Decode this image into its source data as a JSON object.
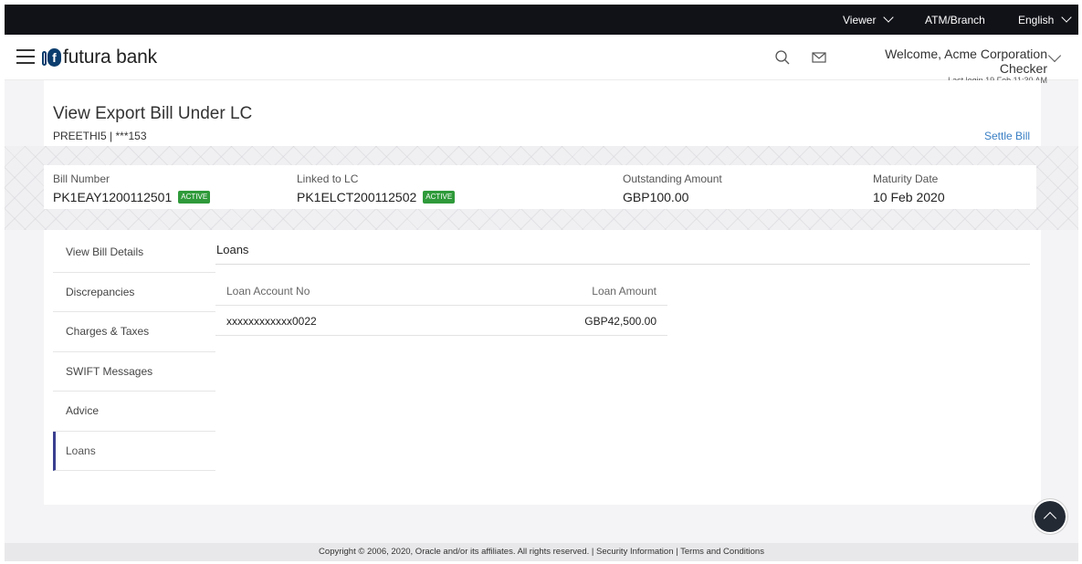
{
  "topbar": {
    "viewer_label": "Viewer",
    "atm_branch_label": "ATM/Branch",
    "language_label": "English"
  },
  "header": {
    "brand_name": "futura bank",
    "logo_letter": "f",
    "welcome_text": "Welcome, Acme Corporation Checker",
    "last_login": "Last login 19 Feb 11:30 AM"
  },
  "page": {
    "title": "View Export Bill Under LC",
    "party": "PREETHI5",
    "account_masked": "***153",
    "settle_label": "Settle Bill"
  },
  "summary": {
    "bill_number_label": "Bill Number",
    "bill_number_value": "PK1EAY1200112501",
    "bill_status": "ACTIVE",
    "linked_lc_label": "Linked to LC",
    "linked_lc_value": "PK1ELCT200112502",
    "lc_status": "ACTIVE",
    "outstanding_label": "Outstanding Amount",
    "outstanding_value": "GBP100.00",
    "maturity_label": "Maturity Date",
    "maturity_value": "10 Feb 2020"
  },
  "nav": {
    "items": [
      {
        "label": "View Bill Details"
      },
      {
        "label": "Discrepancies"
      },
      {
        "label": "Charges & Taxes"
      },
      {
        "label": "SWIFT Messages"
      },
      {
        "label": "Advice"
      },
      {
        "label": "Loans"
      }
    ],
    "active_index": 5
  },
  "loans": {
    "title": "Loans",
    "columns": [
      "Loan Account No",
      "Loan Amount"
    ],
    "rows": [
      [
        "xxxxxxxxxxxx0022",
        "GBP42,500.00"
      ]
    ]
  },
  "footer": {
    "copyright": "Copyright © 2006, 2020, Oracle and/or its affiliates. All rights reserved.",
    "separator": " | ",
    "security_link": "Security Information",
    "terms_link": "Terms and Conditions"
  },
  "colors": {
    "topbar_bg": "#111218",
    "active_badge": "#2f9a3a",
    "link": "#3a7fc4",
    "nav_active_border": "#3a3f8f"
  }
}
